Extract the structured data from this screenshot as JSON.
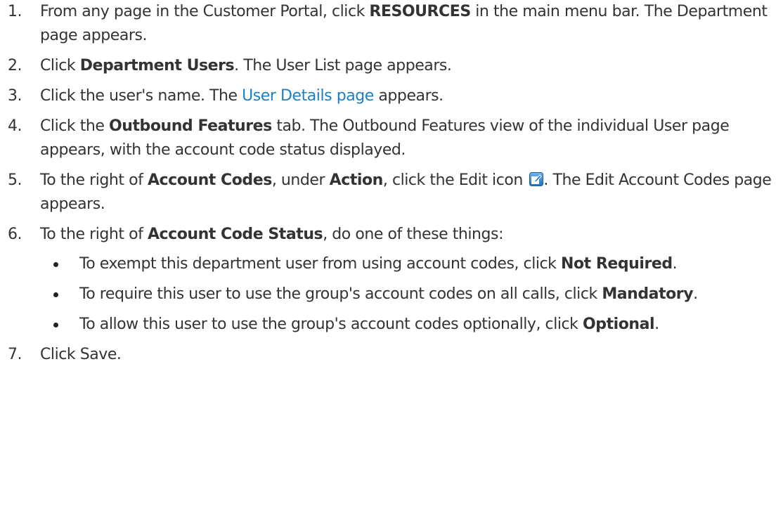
{
  "steps": [
    {
      "num": "1.",
      "parts": [
        "From any page in the Customer Portal, click ",
        "RESOURCES",
        " in the main menu bar. The Department page appears."
      ]
    },
    {
      "num": "2.",
      "parts": [
        "Click ",
        "Department Users",
        ". The User List page appears."
      ]
    },
    {
      "num": "3.",
      "pre": "Click the user's name. The ",
      "link": "User Details page",
      "post": " appears."
    },
    {
      "num": "4.",
      "parts": [
        "Click the ",
        "Outbound Features",
        " tab. The Outbound Features view of the individual User page appears, with the account code status displayed."
      ]
    },
    {
      "num": "5.",
      "parts": [
        "To the right of ",
        "Account Codes",
        ", under ",
        "Action",
        ", click the Edit icon ",
        ". The Edit Account Codes page appears."
      ],
      "icon": "edit-icon"
    },
    {
      "num": "6.",
      "parts": [
        "To the right of ",
        "Account Code Status",
        ", do one of these things:"
      ],
      "bullets": [
        {
          "pre": "To exempt this department user from using account codes, click ",
          "bold": "Not Required",
          "post": "."
        },
        {
          "pre": "To require this user to use the group's account codes on all calls, click ",
          "bold": "Mandatory",
          "post": "."
        },
        {
          "pre": "To allow this user to use the group's account codes optionally, click ",
          "bold": "Optional",
          "post": "."
        }
      ]
    },
    {
      "num": "7.",
      "text": "Click Save."
    }
  ],
  "colors": {
    "text": "#333333",
    "link": "#1e7fc1",
    "icon_bg": "#3a8fd6"
  }
}
